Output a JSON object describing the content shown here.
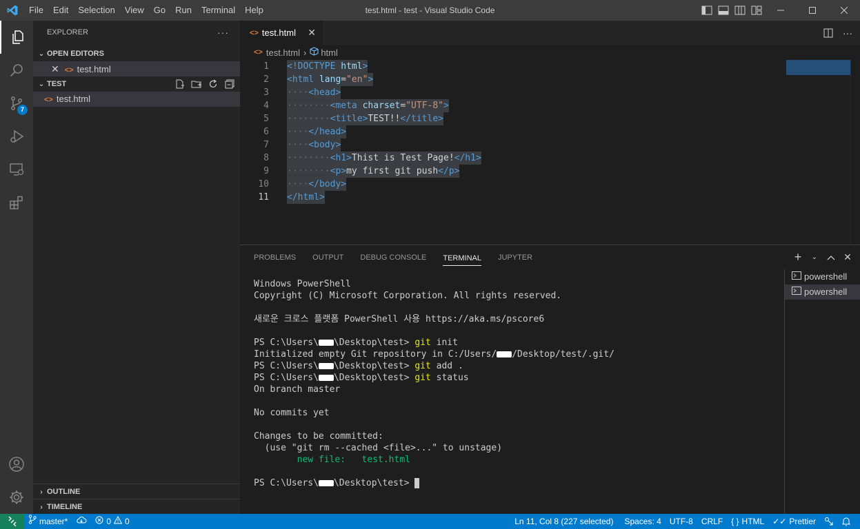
{
  "titlebar": {
    "menu": [
      "File",
      "Edit",
      "Selection",
      "View",
      "Go",
      "Run",
      "Terminal",
      "Help"
    ],
    "window_title": "test.html - test - Visual Studio Code"
  },
  "activitybar": {
    "scm_badge": "7"
  },
  "sidebar": {
    "title": "EXPLORER",
    "more": "···",
    "open_editors_label": "OPEN EDITORS",
    "open_editor_file": "test.html",
    "folder_label": "TEST",
    "files": [
      "test.html"
    ],
    "outline_label": "OUTLINE",
    "timeline_label": "TIMELINE"
  },
  "editor": {
    "tab_label": "test.html",
    "breadcrumb_file": "test.html",
    "breadcrumb_symbol": "html",
    "line_numbers": [
      "1",
      "2",
      "3",
      "4",
      "5",
      "6",
      "7",
      "8",
      "9",
      "10",
      "11"
    ]
  },
  "code_lines": [
    [
      {
        "t": "<!DOCTYPE ",
        "c": "t-tag"
      },
      {
        "t": "html",
        "c": "t-attr"
      },
      {
        "t": ">",
        "c": "t-tag"
      }
    ],
    [
      {
        "t": "<html ",
        "c": "t-tag"
      },
      {
        "t": "lang",
        "c": "t-attr"
      },
      {
        "t": "=",
        "c": "t-txt"
      },
      {
        "t": "\"en\"",
        "c": "t-str"
      },
      {
        "t": ">",
        "c": "t-tag"
      }
    ],
    [
      {
        "t": "····",
        "c": "t-dot"
      },
      {
        "t": "<head>",
        "c": "t-tag"
      }
    ],
    [
      {
        "t": "········",
        "c": "t-dot"
      },
      {
        "t": "<meta ",
        "c": "t-tag"
      },
      {
        "t": "charset",
        "c": "t-attr"
      },
      {
        "t": "=",
        "c": "t-txt"
      },
      {
        "t": "\"UTF-8\"",
        "c": "t-str"
      },
      {
        "t": ">",
        "c": "t-tag"
      }
    ],
    [
      {
        "t": "········",
        "c": "t-dot"
      },
      {
        "t": "<title>",
        "c": "t-tag"
      },
      {
        "t": "TEST!!",
        "c": "t-txt"
      },
      {
        "t": "</title>",
        "c": "t-tag"
      }
    ],
    [
      {
        "t": "····",
        "c": "t-dot"
      },
      {
        "t": "</head>",
        "c": "t-tag"
      }
    ],
    [
      {
        "t": "····",
        "c": "t-dot"
      },
      {
        "t": "<body>",
        "c": "t-tag"
      }
    ],
    [
      {
        "t": "········",
        "c": "t-dot"
      },
      {
        "t": "<h1>",
        "c": "t-tag"
      },
      {
        "t": "Thist is Test Page!",
        "c": "t-txt"
      },
      {
        "t": "</h1>",
        "c": "t-tag"
      }
    ],
    [
      {
        "t": "········",
        "c": "t-dot"
      },
      {
        "t": "<p>",
        "c": "t-tag"
      },
      {
        "t": "my first git push",
        "c": "t-txt"
      },
      {
        "t": "</p>",
        "c": "t-tag"
      }
    ],
    [
      {
        "t": "····",
        "c": "t-dot"
      },
      {
        "t": "</body>",
        "c": "t-tag"
      }
    ],
    [
      {
        "t": "</html>",
        "c": "t-tag"
      }
    ]
  ],
  "panel": {
    "tabs": [
      "PROBLEMS",
      "OUTPUT",
      "DEBUG CONSOLE",
      "TERMINAL",
      "JUPYTER"
    ],
    "active_tab": "TERMINAL",
    "terminals": [
      "powershell",
      "powershell"
    ]
  },
  "terminal_lines": [
    [
      {
        "t": "Windows PowerShell"
      }
    ],
    [
      {
        "t": "Copyright (C) Microsoft Corporation. All rights reserved."
      }
    ],
    [
      {
        "t": ""
      }
    ],
    [
      {
        "t": "새로운 크로스 플랫폼 PowerShell 사용 https://aka.ms/pscore6"
      }
    ],
    [
      {
        "t": ""
      }
    ],
    [
      {
        "t": "PS C:\\Users\\"
      },
      {
        "redact": true
      },
      {
        "t": "\\Desktop\\test> "
      },
      {
        "t": "git",
        "c": "y"
      },
      {
        "t": " init"
      }
    ],
    [
      {
        "t": "Initialized empty Git repository in C:/Users/"
      },
      {
        "redact": true
      },
      {
        "t": "/Desktop/test/.git/"
      }
    ],
    [
      {
        "t": "PS C:\\Users\\"
      },
      {
        "redact": true
      },
      {
        "t": "\\Desktop\\test> "
      },
      {
        "t": "git",
        "c": "y"
      },
      {
        "t": " add ."
      }
    ],
    [
      {
        "t": "PS C:\\Users\\"
      },
      {
        "redact": true
      },
      {
        "t": "\\Desktop\\test> "
      },
      {
        "t": "git",
        "c": "y"
      },
      {
        "t": " status"
      }
    ],
    [
      {
        "t": "On branch master"
      }
    ],
    [
      {
        "t": ""
      }
    ],
    [
      {
        "t": "No commits yet"
      }
    ],
    [
      {
        "t": ""
      }
    ],
    [
      {
        "t": "Changes to be committed:"
      }
    ],
    [
      {
        "t": "  (use \"git rm --cached <file>...\" to unstage)"
      }
    ],
    [
      {
        "t": "        "
      },
      {
        "t": "new file:   test.html",
        "c": "g"
      }
    ],
    [
      {
        "t": ""
      }
    ],
    [
      {
        "t": "PS C:\\Users\\"
      },
      {
        "redact": true
      },
      {
        "t": "\\Desktop\\test> "
      },
      {
        "cursor": true
      }
    ]
  ],
  "statusbar": {
    "branch": "master*",
    "errors": "0",
    "warnings": "0",
    "cursor_pos": "Ln 11, Col 8 (227 selected)",
    "indent": "Spaces: 4",
    "encoding": "UTF-8",
    "eol": "CRLF",
    "language": "HTML",
    "formatter": "Prettier"
  },
  "colors": {
    "accent": "#007acc",
    "remote": "#16825d",
    "selection": "#3a3d41"
  }
}
